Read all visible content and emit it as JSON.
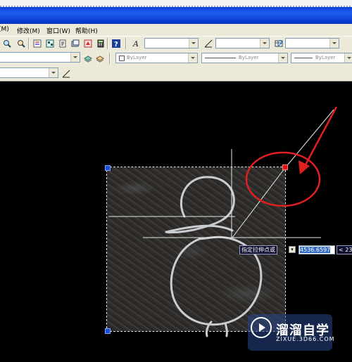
{
  "menu": {
    "items": [
      "(M)",
      "修改(M)",
      "窗口(W)",
      "帮助(H)"
    ]
  },
  "toolbar": {
    "layer_combo": "",
    "text_style_combo": "",
    "dim_style_combo": "",
    "color_combo": "ByLayer",
    "linetype_combo": "ByLayer",
    "lineweight_combo": "ByLayer"
  },
  "dynamic_input": {
    "prompt": "指定拉伸点或",
    "value": "4536.6597",
    "angle": "< 233"
  },
  "watermark": {
    "name": "溜溜自学",
    "url": "ZIXUE.3D66.COM"
  },
  "colors": {
    "accent_red": "#e02020",
    "grip_blue": "#1a4fd6",
    "titlebar_blue": "#0b3fd8"
  }
}
